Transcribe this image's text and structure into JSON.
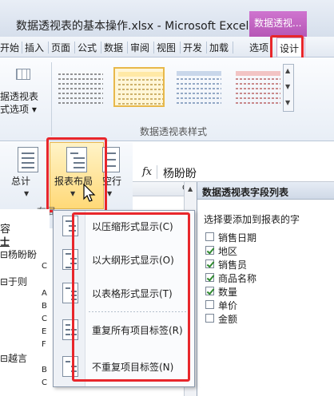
{
  "window": {
    "title": "数据透视表的基本操作.xlsx - Microsoft Excel",
    "context_tab_group": "数据透视..."
  },
  "ribbon_tabs": [
    {
      "label": "开始"
    },
    {
      "label": "插入"
    },
    {
      "label": "页面"
    },
    {
      "label": "公式"
    },
    {
      "label": "数据"
    },
    {
      "label": "审阅"
    },
    {
      "label": "视图"
    },
    {
      "label": "开发"
    },
    {
      "label": "加载"
    },
    {
      "label": "选项"
    },
    {
      "label": "设计",
      "active": true
    }
  ],
  "style_options": {
    "label_line1": "据透视表",
    "label_line2": "式选项 ▾"
  },
  "pivot_styles_group": {
    "label": "数据透视表样式",
    "selected_index": 1
  },
  "layout_group": {
    "subtotal_label": "总计",
    "report_layout_label": "报表布局",
    "blank_rows_label": "空行",
    "group_label": "布局"
  },
  "formula_bar": {
    "fx_label": "fx",
    "value": "杨盼盼"
  },
  "column_header": "C",
  "sheet": {
    "cells": [
      "容",
      "士",
      "⊟杨盼盼",
      "⊟于则",
      "⊟越言"
    ],
    "row_letters": [
      "C",
      "A",
      "B",
      "C",
      "E",
      "F",
      "B",
      "C"
    ]
  },
  "report_layout_menu": {
    "items": [
      {
        "label": "以压缩形式显示(C)"
      },
      {
        "label": "以大纲形式显示(O)"
      },
      {
        "label": "以表格形式显示(T)"
      },
      {
        "label": "重复所有项目标签(R)"
      },
      {
        "label": "不重复项目标签(N)"
      }
    ]
  },
  "field_list": {
    "title": "数据透视表字段列表",
    "instruction": "选择要添加到报表的字",
    "fields": [
      {
        "label": "销售日期",
        "checked": false
      },
      {
        "label": "地区",
        "checked": true
      },
      {
        "label": "销售员",
        "checked": true
      },
      {
        "label": "商品名称",
        "checked": true
      },
      {
        "label": "数量",
        "checked": true
      },
      {
        "label": "单价",
        "checked": false
      },
      {
        "label": "金额",
        "checked": false
      }
    ]
  },
  "colors": {
    "highlight_box": "#e8262b",
    "context_tab": "#c266c2",
    "selected_style_border": "#e8b84a",
    "checkmark": "#2f8a2f"
  }
}
